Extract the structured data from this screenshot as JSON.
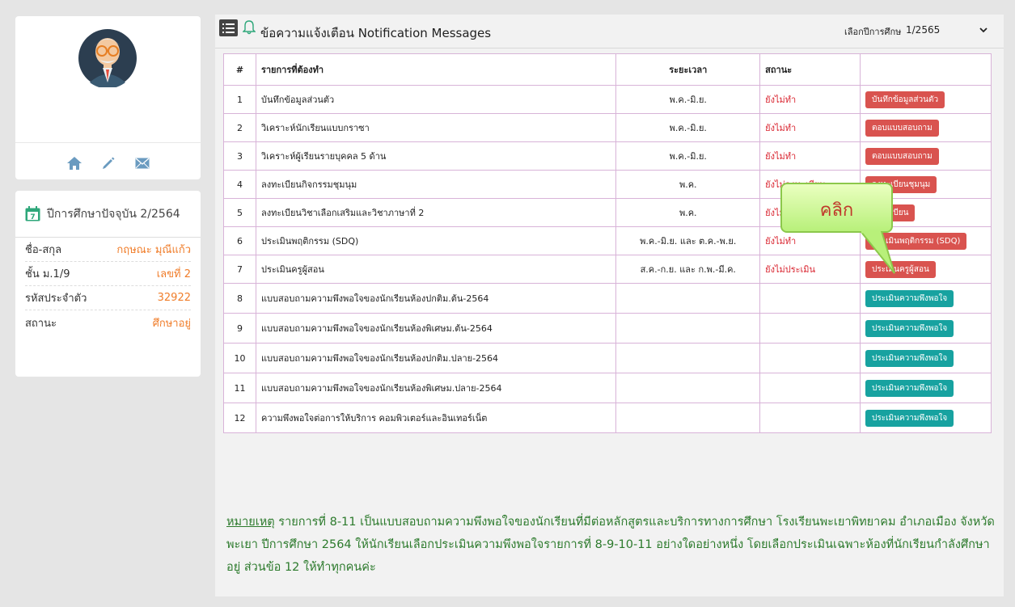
{
  "profile": {
    "icons": [
      "home-icon",
      "pencil-icon",
      "mail-icon"
    ]
  },
  "year_info": {
    "title": "ปีการศึกษาปัจจุบัน 2/2564",
    "rows": [
      {
        "label": "ชื่อ-สกุล",
        "value": "กฤษณะ มุณีแก้ว"
      },
      {
        "label": "ชั้น ม.1/9",
        "value": "เลขที่ 2"
      },
      {
        "label": "รหัสประจำตัว",
        "value": "32922"
      },
      {
        "label": "สถานะ",
        "value": "ศึกษาอยู่"
      }
    ]
  },
  "header": {
    "title": "ข้อความแจ้งเตือน Notification Messages",
    "year_label": "เลือกปีการศึกษา",
    "year_value": "1/2565"
  },
  "table": {
    "columns": [
      "#",
      "รายการที่ต้องทำ",
      "ระยะเวลา",
      "สถานะ",
      ""
    ],
    "rows": [
      {
        "num": "1",
        "task": "บันทึกข้อมูลส่วนตัว",
        "period": "พ.ค.-มิ.ย.",
        "status": "ยังไม่ทำ",
        "action": "บันทึกข้อมูลส่วนตัว",
        "color": "red"
      },
      {
        "num": "2",
        "task": "วิเคราะห์นักเรียนแบบกราซา",
        "period": "พ.ค.-มิ.ย.",
        "status": "ยังไม่ทำ",
        "action": "ตอบแบบสอบถาม",
        "color": "red"
      },
      {
        "num": "3",
        "task": "วิเคราะห์ผู้เรียนรายบุคคล 5 ด้าน",
        "period": "พ.ค.-มิ.ย.",
        "status": "ยังไม่ทำ",
        "action": "ตอบแบบสอบถาม",
        "color": "red"
      },
      {
        "num": "4",
        "task": "ลงทะเบียนกิจกรรมชุมนุม",
        "period": "พ.ค.",
        "status": "ยังไม่ลงทะเบียน",
        "action": "ลงทะเบียนชุมนุม",
        "color": "red"
      },
      {
        "num": "5",
        "task": "ลงทะเบียนวิชาเลือกเสริมและวิชาภาษาที่ 2",
        "period": "พ.ค.",
        "status": "ยังไม่ลงทะเบียน",
        "action": "ลงทะเบียน",
        "color": "red"
      },
      {
        "num": "6",
        "task": "ประเมินพฤติกรรม (SDQ)",
        "period": "พ.ค.-มิ.ย. และ ต.ค.-พ.ย.",
        "status": "ยังไม่ทำ",
        "action": "ประเมินพฤติกรรม (SDQ)",
        "color": "red"
      },
      {
        "num": "7",
        "task": "ประเมินครูผู้สอน",
        "period": "ส.ค.-ก.ย. และ ก.พ.-มี.ค.",
        "status": "ยังไม่ประเมิน",
        "action": "ประเมินครูผู้สอน",
        "color": "red"
      },
      {
        "num": "8",
        "task": "แบบสอบถามความพึงพอใจของนักเรียนห้องปกติม.ต้น-2564",
        "period": "",
        "status": "",
        "action": "ประเมินความพึงพอใจ",
        "color": "teal"
      },
      {
        "num": "9",
        "task": "แบบสอบถามความพึงพอใจของนักเรียนห้องพิเศษม.ต้น-2564",
        "period": "",
        "status": "",
        "action": "ประเมินความพึงพอใจ",
        "color": "teal"
      },
      {
        "num": "10",
        "task": "แบบสอบถามความพึงพอใจของนักเรียนห้องปกติม.ปลาย-2564",
        "period": "",
        "status": "",
        "action": "ประเมินความพึงพอใจ",
        "color": "teal"
      },
      {
        "num": "11",
        "task": "แบบสอบถามความพึงพอใจของนักเรียนห้องพิเศษม.ปลาย-2564",
        "period": "",
        "status": "",
        "action": "ประเมินความพึงพอใจ",
        "color": "teal"
      },
      {
        "num": "12",
        "task": "ความพึงพอใจต่อการให้บริการ คอมพิวเตอร์และอินเทอร์เน็ต",
        "period": "",
        "status": "",
        "action": "ประเมินความพึงพอใจ",
        "color": "teal"
      }
    ]
  },
  "note": {
    "label": "หมายเหตุ",
    "text": " รายการที่ 8-11 เป็นแบบสอบถามความพึงพอใจของนักเรียนที่มีต่อหลักสูตรและบริการทางการศึกษา โรงเรียนพะเยาพิทยาคม อำเภอเมือง จังหวัดพะเยา ปีการศึกษา 2564 ให้นักเรียนเลือกประเมินความพึงพอใจรายการที่ 8-9-10-11 อย่างใดอย่างหนึ่ง โดยเลือกประเมินเฉพาะห้องที่นักเรียนกำลังศึกษาอยู่ ส่วนข้อ 12 ให้ทำทุกคนค่ะ"
  },
  "callout": {
    "text": "คลิก"
  },
  "colors": {
    "accent_orange": "#f07d2a",
    "status_red": "#d9232e",
    "btn_red": "#d9534f",
    "btn_teal": "#17a2a0",
    "note_green": "#2c7a2c"
  }
}
